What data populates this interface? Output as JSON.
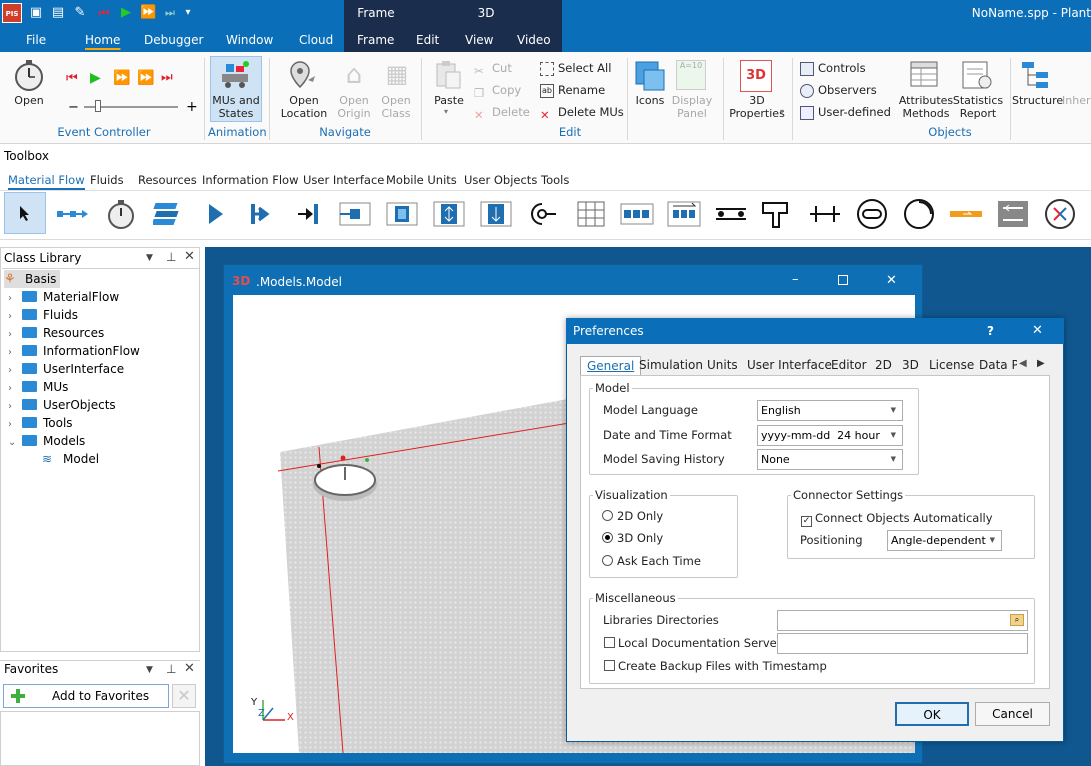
{
  "app": {
    "window_title": "NoName.spp - Plant",
    "logo_text": "PIS",
    "context_groups": {
      "frame": "Frame",
      "threed": "3D"
    }
  },
  "menu_tabs": [
    "File",
    "Home",
    "Debugger",
    "Window",
    "Cloud",
    "Frame",
    "Edit",
    "View",
    "Video"
  ],
  "ribbon": {
    "event_controller": {
      "open": "Open",
      "group": "Event Controller",
      "slider_minus": "−",
      "slider_plus": "+"
    },
    "animation": {
      "mus_states": "MUs and States",
      "group": "Animation"
    },
    "navigate": {
      "open_location": "Open Location",
      "open_origin": "Open Origin",
      "open_class": "Open Class",
      "group": "Navigate"
    },
    "edit": {
      "paste": "Paste",
      "cut": "Cut",
      "copy": "Copy",
      "delete": "Delete",
      "select_all": "Select All",
      "rename": "Rename",
      "delete_mus": "Delete MUs",
      "group": "Edit"
    },
    "icons": {
      "icons": "Icons",
      "display_panel": "Display Panel"
    },
    "properties": {
      "label": "3D Properties"
    },
    "objects": {
      "controls": "Controls",
      "observers": "Observers",
      "user_defined": "User-defined",
      "attributes_methods": "Attributes Methods",
      "statistics_report": "Statistics Report",
      "group": "Objects"
    },
    "structure": {
      "structure": "Structure",
      "inherit": "Inher"
    }
  },
  "toolbox": {
    "title": "Toolbox",
    "tabs": [
      "Material Flow",
      "Fluids",
      "Resources",
      "Information Flow",
      "User Interface",
      "Mobile Units",
      "User Objects",
      "Tools"
    ]
  },
  "class_library": {
    "title": "Class Library",
    "root": "Basis",
    "folders": [
      "MaterialFlow",
      "Fluids",
      "Resources",
      "InformationFlow",
      "UserInterface",
      "MUs",
      "UserObjects",
      "Tools",
      "Models"
    ],
    "model_item": "Model"
  },
  "favorites": {
    "title": "Favorites",
    "add_button": "Add to Favorites"
  },
  "window3d": {
    "badge": "3D",
    "title": ".Models.Model",
    "axes": {
      "y": "Y",
      "z": "Z",
      "x": "X"
    }
  },
  "preferences": {
    "title": "Preferences",
    "help": "?",
    "tabs": [
      "General",
      "Simulation",
      "Units",
      "User Interface",
      "Editor",
      "2D",
      "3D",
      "License",
      "Data Pr"
    ],
    "model": {
      "legend": "Model",
      "language_label": "Model Language",
      "language_value": "English",
      "datetime_label": "Date and Time Format",
      "datetime_value": "yyyy-mm-dd  24 hour",
      "history_label": "Model Saving History",
      "history_value": "None"
    },
    "visualization": {
      "legend": "Visualization",
      "options": [
        "2D Only",
        "3D Only",
        "Ask Each Time"
      ],
      "selected": "3D Only"
    },
    "connector": {
      "legend": "Connector Settings",
      "auto_label": "Connect Objects Automatically",
      "auto_checked": true,
      "positioning_label": "Positioning",
      "positioning_value": "Angle-dependent"
    },
    "misc": {
      "legend": "Miscellaneous",
      "lib_dirs_label": "Libraries Directories",
      "lib_dirs_value": "",
      "local_doc_label": "Local Documentation Server",
      "local_doc_value": "",
      "backup_label": "Create Backup Files with Timestamp"
    },
    "ok": "OK",
    "cancel": "Cancel"
  }
}
